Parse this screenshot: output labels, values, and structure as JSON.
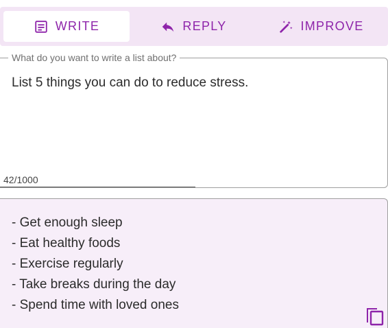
{
  "tabs": [
    {
      "label": "WRITE",
      "icon": "note-icon",
      "active": true
    },
    {
      "label": "REPLY",
      "icon": "reply-icon",
      "active": false
    },
    {
      "label": "IMPROVE",
      "icon": "magic-wand-icon",
      "active": false
    }
  ],
  "prompt": {
    "label": "What do you want to write a list about?",
    "value": "List 5 things you can do to reduce stress.",
    "char_count": "42/1000"
  },
  "output": {
    "items": [
      "- Get enough sleep",
      "- Eat healthy foods",
      "- Exercise regularly",
      "- Take breaks during the day",
      "- Spend time with loved ones"
    ],
    "copy_icon": "copy-icon"
  },
  "colors": {
    "accent": "#8e24aa",
    "tabbar_bg": "#f3e5f5",
    "output_bg": "#f7eef9"
  }
}
